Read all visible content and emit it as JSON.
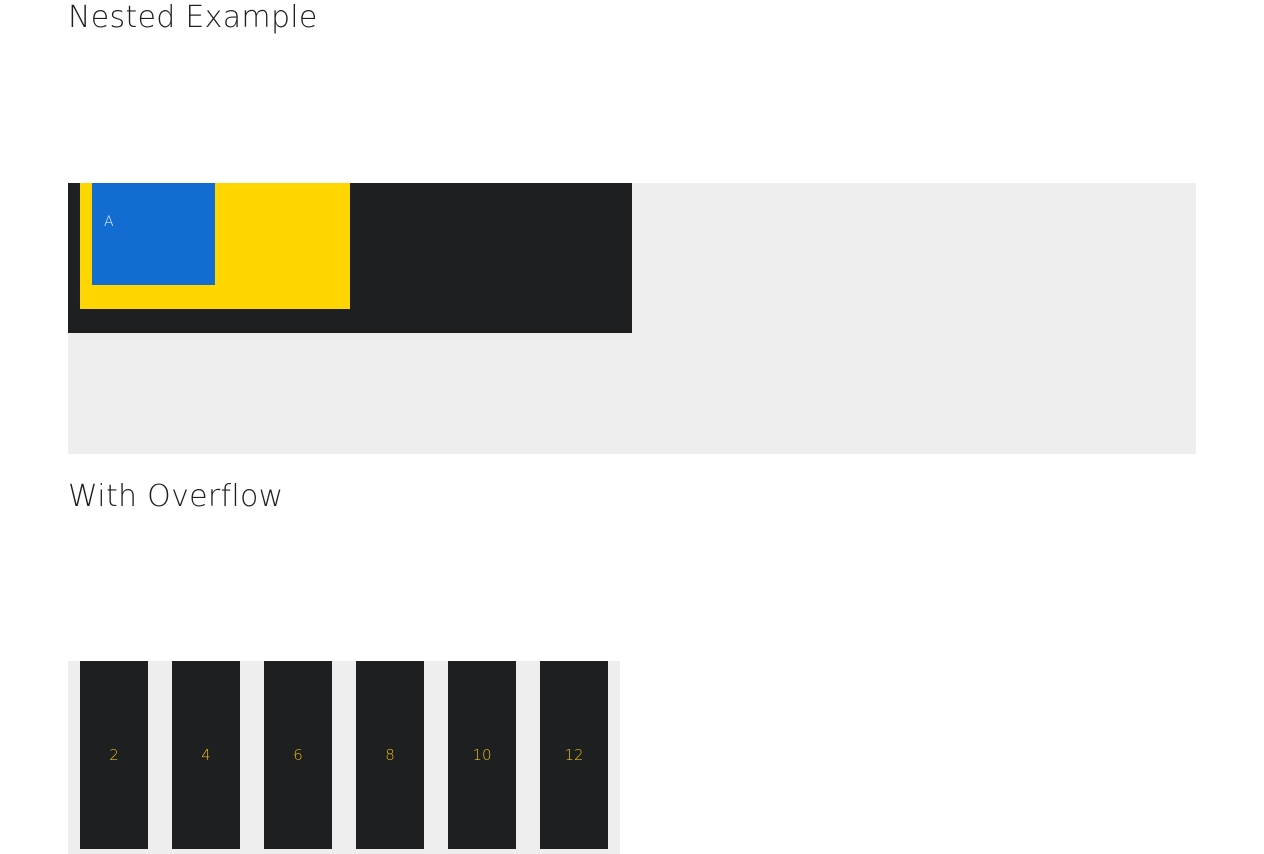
{
  "sections": {
    "nested": {
      "title": "Nested Example",
      "inner_label": "A"
    },
    "overflow": {
      "title": "With Overflow",
      "items": [
        {
          "label": "2"
        },
        {
          "label": "4"
        },
        {
          "label": "6"
        },
        {
          "label": "8"
        },
        {
          "label": "10"
        },
        {
          "label": "12"
        }
      ]
    }
  },
  "colors": {
    "dark": "#1e1f21",
    "yellow": "#ffd600",
    "blue": "#136ccf",
    "light_gray": "#eeeeee",
    "number_text": "#e8b90a"
  }
}
